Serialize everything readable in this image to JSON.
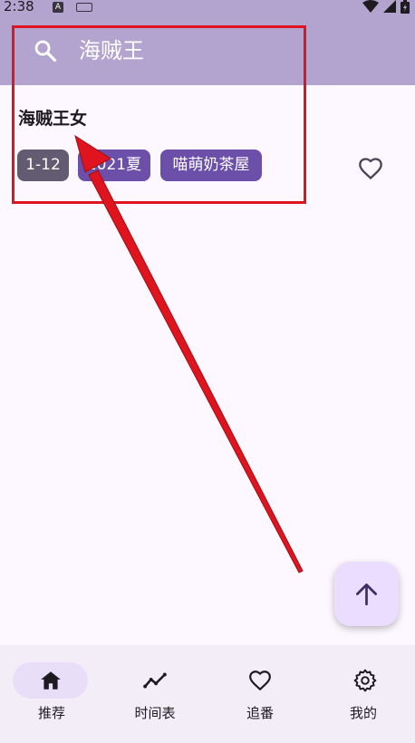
{
  "status_bar": {
    "time": "2:38",
    "notification_letter": "A"
  },
  "search": {
    "query": "海贼王"
  },
  "result": {
    "title": "海贼王女",
    "tags": [
      "1-12",
      "2021夏",
      "喵萌奶茶屋"
    ],
    "favorite_icon": "heart-outline-icon"
  },
  "fab": {
    "icon": "arrow-up-icon"
  },
  "bottom_nav": {
    "items": [
      {
        "label": "推荐",
        "icon": "home-icon",
        "active": true
      },
      {
        "label": "时间表",
        "icon": "trend-line-icon",
        "active": false
      },
      {
        "label": "追番",
        "icon": "heart-icon",
        "active": false
      },
      {
        "label": "我的",
        "icon": "gear-icon",
        "active": false
      }
    ]
  },
  "colors": {
    "app_bar": "#b3a3cf",
    "background": "#fdf7ff",
    "tag_primary": "#6b4fa8",
    "tag_secondary": "#625b71",
    "annotation_red": "#e0141e",
    "fab": "#eaddff",
    "nav_background": "#f3edf7"
  }
}
